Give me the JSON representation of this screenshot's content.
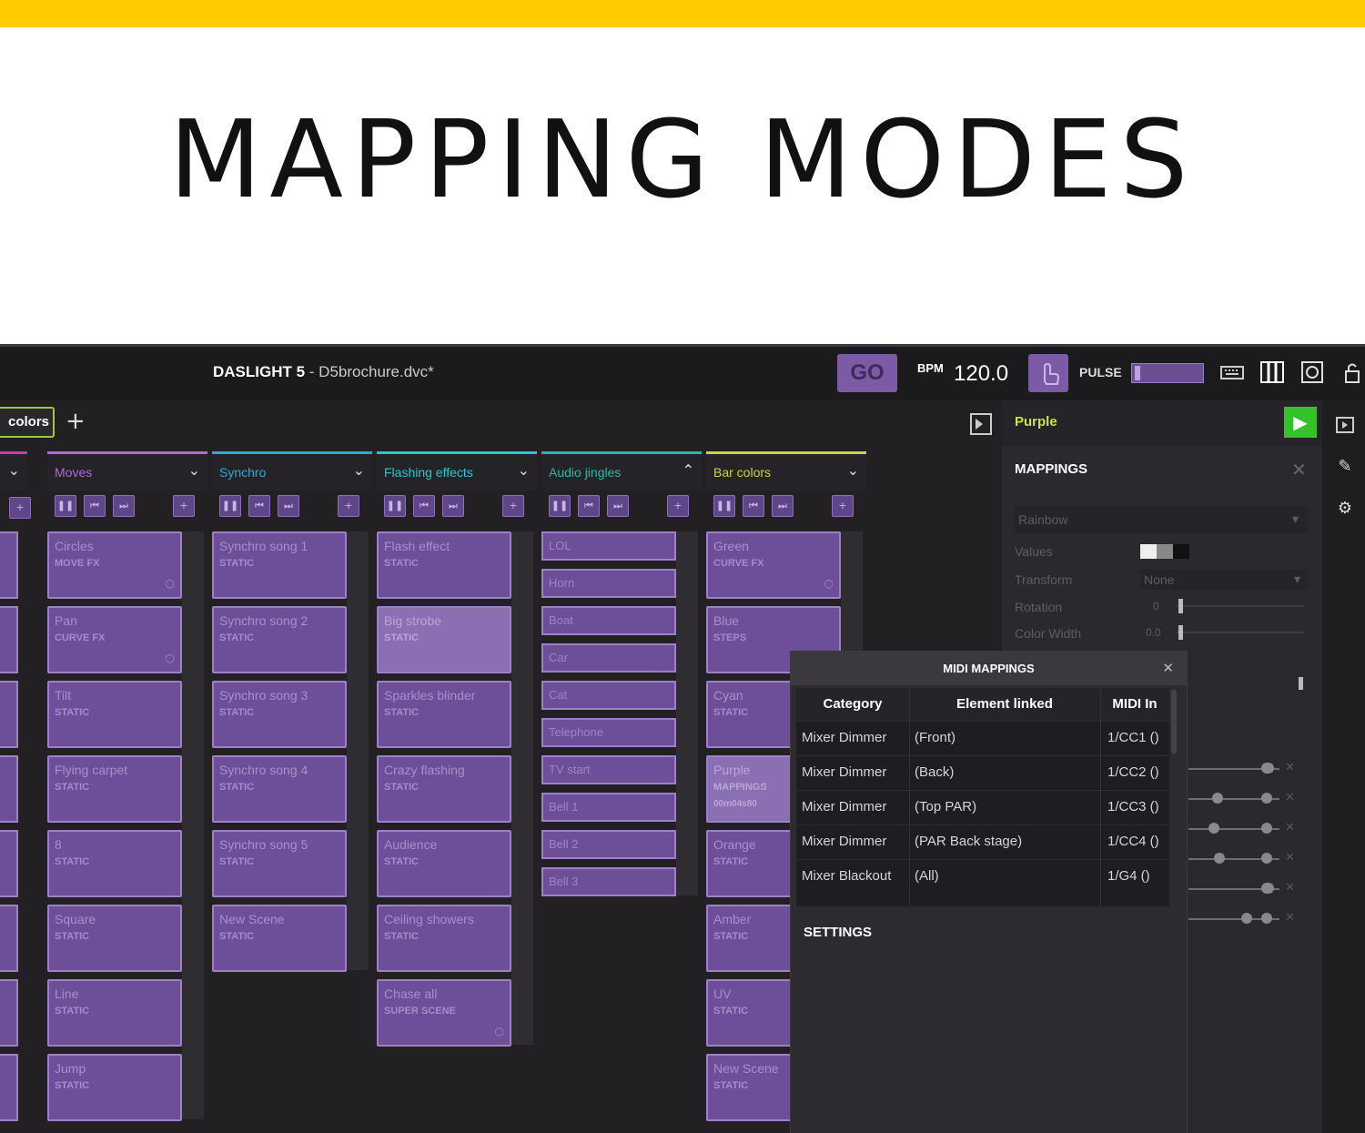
{
  "banner": {
    "title": "MAPPING MODES"
  },
  "app": {
    "name": "DASLIGHT 5",
    "file": "- D5brochure.dvc*",
    "go_label": "GO",
    "bpm_label": "BPM",
    "bpm_value": "120.0",
    "pulse_label": "PULSE"
  },
  "tabs": {
    "active": "colors",
    "add": "+"
  },
  "columns": [
    {
      "name": "Moves",
      "color": "#b06ad6",
      "scenes": [
        {
          "title": "Circles",
          "sub": "MOVE FX"
        },
        {
          "title": "Pan",
          "sub": "CURVE FX"
        },
        {
          "title": "Tilt",
          "sub": "STATIC"
        },
        {
          "title": "Flying carpet",
          "sub": "STATIC"
        },
        {
          "title": "8",
          "sub": "STATIC"
        },
        {
          "title": "Square",
          "sub": "STATIC"
        },
        {
          "title": "Line",
          "sub": "STATIC"
        },
        {
          "title": "Jump",
          "sub": "STATIC"
        }
      ]
    },
    {
      "name": "Synchro",
      "color": "#2aa9e0",
      "scenes": [
        {
          "title": "Synchro song 1",
          "sub": "STATIC"
        },
        {
          "title": "Synchro song 2",
          "sub": "STATIC"
        },
        {
          "title": "Synchro song 3",
          "sub": "STATIC"
        },
        {
          "title": "Synchro song 4",
          "sub": "STATIC"
        },
        {
          "title": "Synchro song 5",
          "sub": "STATIC"
        },
        {
          "title": "New Scene",
          "sub": "STATIC"
        }
      ]
    },
    {
      "name": "Flashing effects",
      "color": "#24c7d6",
      "scenes": [
        {
          "title": "Flash effect",
          "sub": "STATIC"
        },
        {
          "title": "Big strobe",
          "sub": "STATIC"
        },
        {
          "title": "Sparkles blinder",
          "sub": "STATIC"
        },
        {
          "title": "Crazy flashing",
          "sub": "STATIC"
        },
        {
          "title": "Audience",
          "sub": "STATIC"
        },
        {
          "title": "Ceiling showers",
          "sub": "STATIC"
        },
        {
          "title": "Chase all",
          "sub": "SUPER SCENE"
        }
      ]
    },
    {
      "name": "Audio jingles",
      "color": "#2ab7a9",
      "sounds": [
        "LOL",
        "Horn",
        "Boat",
        "Car",
        "Cat",
        "Telephone",
        "TV start",
        "Bell 1",
        "Bell 2",
        "Bell 3"
      ]
    },
    {
      "name": "Bar colors",
      "color": "#c6d63a",
      "scenes": [
        {
          "title": "Green",
          "sub": "CURVE FX"
        },
        {
          "title": "Blue",
          "sub": "STEPS"
        },
        {
          "title": "Cyan",
          "sub": "STATIC"
        },
        {
          "title": "Purple",
          "sub": "MAPPINGS",
          "sub2": "00m04s80"
        },
        {
          "title": "Orange",
          "sub": "STATIC"
        },
        {
          "title": "Amber",
          "sub": "STATIC"
        },
        {
          "title": "UV",
          "sub": "STATIC"
        },
        {
          "title": "New Scene",
          "sub": "STATIC"
        }
      ]
    }
  ],
  "right_panel": {
    "scene_name": "Purple",
    "mappings_header": "MAPPINGS",
    "mode": "Rainbow",
    "values_label": "Values",
    "transform_label": "Transform",
    "transform_value": "None",
    "rotation_label": "Rotation",
    "rotation_value": "0",
    "color_width_label": "Color Width",
    "color_width_value": "0.0"
  },
  "midi_dialog": {
    "title": "MIDI MAPPINGS",
    "headers": [
      "Category",
      "Element linked",
      "MIDI In"
    ],
    "rows": [
      {
        "category": "Mixer Dimmer",
        "element": "(Front)",
        "midi": "1/CC1 ()"
      },
      {
        "category": "Mixer Dimmer",
        "element": "(Back)",
        "midi": "1/CC2 ()"
      },
      {
        "category": "Mixer Dimmer",
        "element": "(Top PAR)",
        "midi": "1/CC3 ()"
      },
      {
        "category": "Mixer Dimmer",
        "element": "(PAR Back stage)",
        "midi": "1/CC4 ()"
      },
      {
        "category": "Mixer Blackout",
        "element": "(All)",
        "midi": "1/G4 ()"
      }
    ],
    "settings_label": "SETTINGS"
  }
}
